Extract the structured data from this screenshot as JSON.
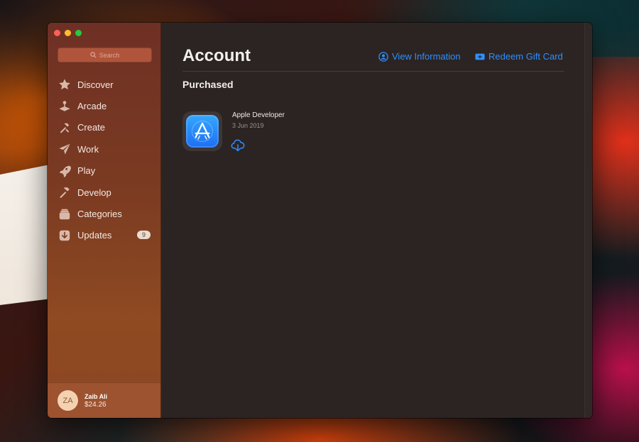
{
  "window": {
    "traffic_lights": [
      "close",
      "minimize",
      "zoom"
    ]
  },
  "sidebar": {
    "search": {
      "placeholder": "Search",
      "icon": "search-icon"
    },
    "items": [
      {
        "label": "Discover",
        "icon": "star-icon"
      },
      {
        "label": "Arcade",
        "icon": "joystick-icon"
      },
      {
        "label": "Create",
        "icon": "hammer-brush-icon"
      },
      {
        "label": "Work",
        "icon": "paper-plane-icon"
      },
      {
        "label": "Play",
        "icon": "rocket-icon"
      },
      {
        "label": "Develop",
        "icon": "hammer-icon"
      },
      {
        "label": "Categories",
        "icon": "stack-icon"
      },
      {
        "label": "Updates",
        "icon": "download-icon",
        "badge": "9"
      }
    ],
    "user": {
      "initials": "ZA",
      "name": "Zaib Ali",
      "balance": "$24.26"
    }
  },
  "main": {
    "title": "Account",
    "links": {
      "view_information": "View Information",
      "redeem_gift_card": "Redeem Gift Card"
    },
    "section_title": "Purchased",
    "purchased": [
      {
        "name": "Apple Developer",
        "date": "3 Jun 2019",
        "icon": "app-store-icon",
        "action_icon": "icloud-download-icon"
      }
    ]
  },
  "colors": {
    "accent": "#2e8fff",
    "sidebar_top": "#6e3024",
    "sidebar_bottom": "#8c4523",
    "main_bg": "#2b2423"
  }
}
